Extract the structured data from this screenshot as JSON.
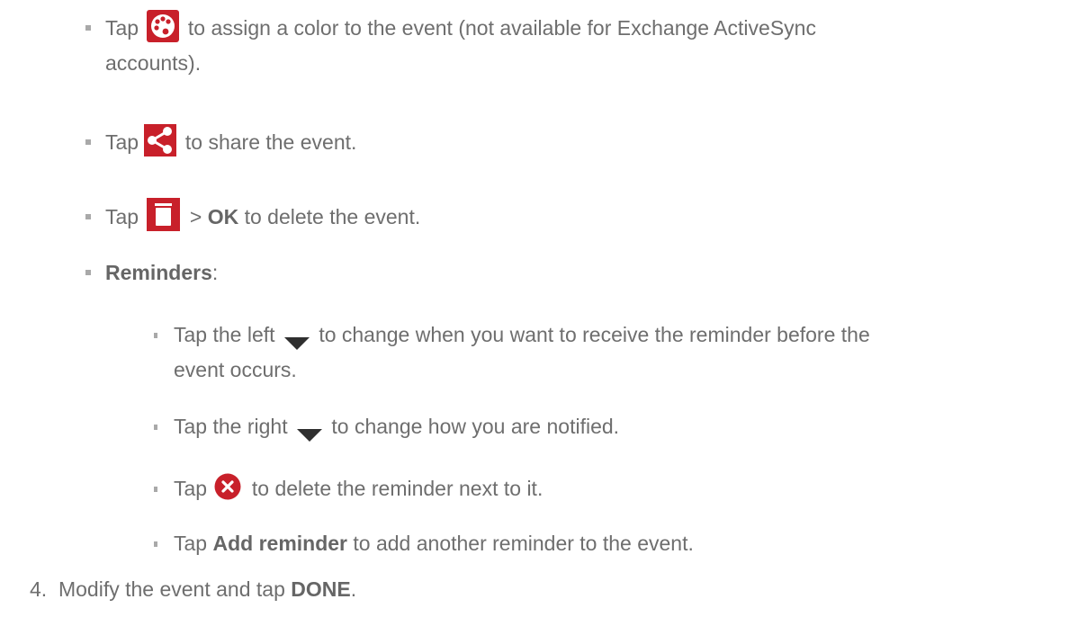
{
  "items": {
    "color": {
      "tap": "Tap",
      "icon": "palette-icon",
      "text_1": "to assign a color to the event (not available for Exchange ActiveSync",
      "text_2": "accounts)."
    },
    "share": {
      "tap": "Tap",
      "icon": "share-icon",
      "text": "to share the event."
    },
    "delete": {
      "tap": "Tap",
      "icon": "trash-icon",
      "gt": ">",
      "ok": "OK",
      "text": "to delete the event."
    },
    "reminders": {
      "label": "Reminders",
      "colon": ":",
      "sub": {
        "left": {
          "text_a": "Tap the left",
          "icon": "dropdown-arrow-icon",
          "text_b": "to change when you want to receive the reminder before the",
          "text_c": "event occurs."
        },
        "right": {
          "text_a": "Tap the right",
          "icon": "dropdown-arrow-icon",
          "text_b": "to change how you are notified."
        },
        "remove": {
          "tap": "Tap",
          "icon": "close-circle-icon",
          "text": "to delete the reminder next to it."
        },
        "add": {
          "tap": "Tap",
          "bold": "Add reminder",
          "text": "to add another reminder to the event."
        }
      }
    }
  },
  "step": {
    "number": "4.",
    "text": "Modify the event and tap",
    "bold": "DONE",
    "period": "."
  },
  "colors": {
    "icon_red": "#c8202a",
    "text_gray": "#6e6e6e",
    "bullet_gray": "#a9a9a9"
  }
}
